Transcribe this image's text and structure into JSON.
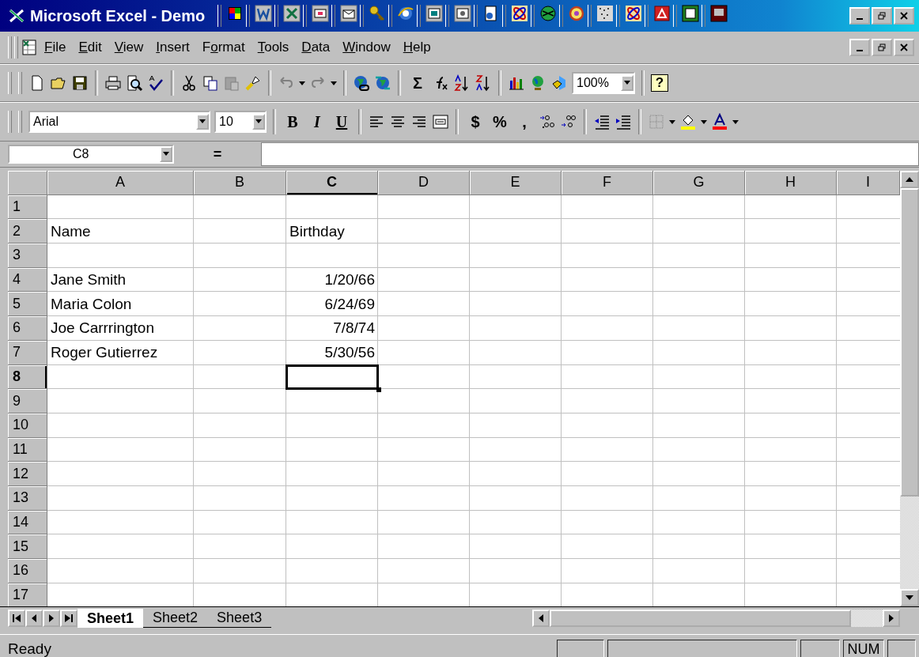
{
  "window": {
    "title": "Microsoft Excel - Demo"
  },
  "menu": [
    {
      "accel": "F",
      "rest": "ile"
    },
    {
      "accel": "E",
      "rest": "dit"
    },
    {
      "accel": "V",
      "rest": "iew"
    },
    {
      "accel": "I",
      "rest": "nsert"
    },
    {
      "lead": "F",
      "accel": "o",
      "rest": "rmat"
    },
    {
      "accel": "T",
      "rest": "ools"
    },
    {
      "accel": "D",
      "rest": "ata"
    },
    {
      "accel": "W",
      "rest": "indow"
    },
    {
      "accel": "H",
      "rest": "elp"
    }
  ],
  "standard_toolbar": {
    "undo": {
      "disabled": true
    },
    "redo": {
      "disabled": true
    },
    "autosum": "Σ",
    "zoom": "100%",
    "help": "?"
  },
  "formatting_toolbar": {
    "font": "Arial",
    "size": "10",
    "bold": "B",
    "italic": "I",
    "underline": "U",
    "currency": "$",
    "percent": "%",
    "comma": ","
  },
  "formula_bar": {
    "name_box": "C8",
    "equals": "="
  },
  "sheet": {
    "columns": [
      {
        "label": "A",
        "selected": false
      },
      {
        "label": "B",
        "selected": false
      },
      {
        "label": "C",
        "selected": true
      },
      {
        "label": "D",
        "selected": false
      },
      {
        "label": "E",
        "selected": false
      },
      {
        "label": "F",
        "selected": false
      },
      {
        "label": "G",
        "selected": false
      },
      {
        "label": "H",
        "selected": false
      },
      {
        "label": "I",
        "selected": false
      }
    ],
    "rows": [
      {
        "label": "1",
        "selected": false
      },
      {
        "label": "2",
        "selected": false,
        "cells": [
          {
            "kind": "text",
            "text": "Name"
          },
          {
            "kind": "blank"
          },
          {
            "kind": "text",
            "text": "Birthday"
          }
        ]
      },
      {
        "label": "3",
        "selected": false
      },
      {
        "label": "4",
        "selected": false,
        "cells": [
          {
            "kind": "text",
            "text": "Jane Smith"
          },
          {
            "kind": "blank"
          },
          {
            "kind": "date",
            "text": "1/20/66"
          }
        ]
      },
      {
        "label": "5",
        "selected": false,
        "cells": [
          {
            "kind": "text",
            "text": "Maria Colon"
          },
          {
            "kind": "blank"
          },
          {
            "kind": "date",
            "text": "6/24/69"
          }
        ]
      },
      {
        "label": "6",
        "selected": false,
        "cells": [
          {
            "kind": "text",
            "text": "Joe Carrrington"
          },
          {
            "kind": "blank"
          },
          {
            "kind": "date",
            "text": "7/8/74"
          }
        ]
      },
      {
        "label": "7",
        "selected": false,
        "cells": [
          {
            "kind": "text",
            "text": "Roger Gutierrez"
          },
          {
            "kind": "blank"
          },
          {
            "kind": "date",
            "text": "5/30/56"
          }
        ]
      },
      {
        "label": "8",
        "selected": true
      },
      {
        "label": "9",
        "selected": false
      },
      {
        "label": "10",
        "selected": false
      },
      {
        "label": "11",
        "selected": false
      },
      {
        "label": "12",
        "selected": false
      },
      {
        "label": "13",
        "selected": false
      },
      {
        "label": "14",
        "selected": false
      },
      {
        "label": "15",
        "selected": false
      },
      {
        "label": "16",
        "selected": false
      },
      {
        "label": "17",
        "selected": false
      }
    ]
  },
  "sheet_tabs": [
    {
      "label": "Sheet1",
      "selected": true
    },
    {
      "label": "Sheet2",
      "selected": false
    },
    {
      "label": "Sheet3",
      "selected": false
    }
  ],
  "status_bar": {
    "message": "Ready",
    "indicators": [
      "NUM"
    ]
  }
}
